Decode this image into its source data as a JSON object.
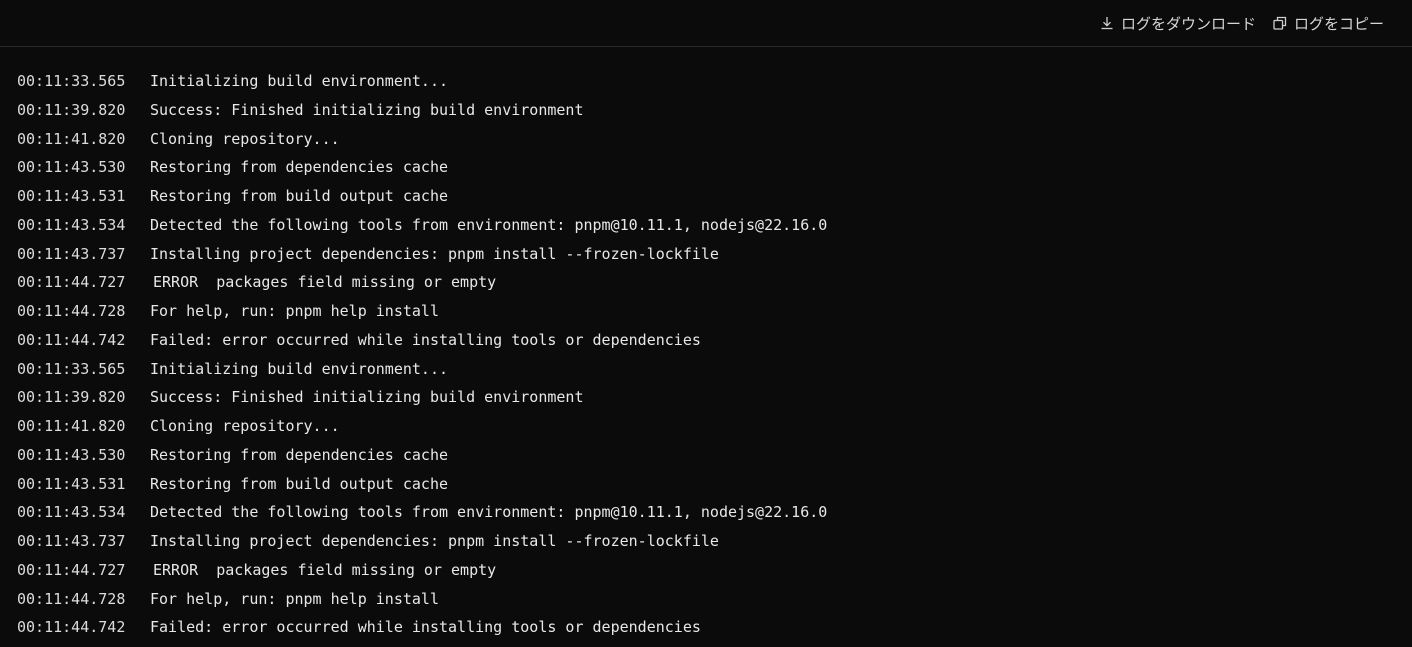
{
  "toolbar": {
    "download_label": "ログをダウンロード",
    "download_icon": "download-icon",
    "copy_label": "ログをコピー",
    "copy_icon": "copy-icon"
  },
  "log": [
    {
      "time": "00:11:33.565",
      "message": "Initializing build environment..."
    },
    {
      "time": "00:11:39.820",
      "message": "Success: Finished initializing build environment"
    },
    {
      "time": "00:11:41.820",
      "message": "Cloning repository..."
    },
    {
      "time": "00:11:43.530",
      "message": "Restoring from dependencies cache"
    },
    {
      "time": "00:11:43.531",
      "message": "Restoring from build output cache"
    },
    {
      "time": "00:11:43.534",
      "message": "Detected the following tools from environment: pnpm@10.11.1, nodejs@22.16.0"
    },
    {
      "time": "00:11:43.737",
      "message": "Installing project dependencies: pnpm install --frozen-lockfile"
    },
    {
      "time": "00:11:44.727",
      "message": "ERROR  packages field missing or empty"
    },
    {
      "time": "00:11:44.728",
      "message": "For help, run: pnpm help install"
    },
    {
      "time": "00:11:44.742",
      "message": "Failed: error occurred while installing tools or dependencies"
    },
    {
      "time": "00:11:33.565",
      "message": "Initializing build environment..."
    },
    {
      "time": "00:11:39.820",
      "message": "Success: Finished initializing build environment"
    },
    {
      "time": "00:11:41.820",
      "message": "Cloning repository..."
    },
    {
      "time": "00:11:43.530",
      "message": "Restoring from dependencies cache"
    },
    {
      "time": "00:11:43.531",
      "message": "Restoring from build output cache"
    },
    {
      "time": "00:11:43.534",
      "message": "Detected the following tools from environment: pnpm@10.11.1, nodejs@22.16.0"
    },
    {
      "time": "00:11:43.737",
      "message": "Installing project dependencies: pnpm install --frozen-lockfile"
    },
    {
      "time": "00:11:44.727",
      "message": "ERROR  packages field missing or empty"
    },
    {
      "time": "00:11:44.728",
      "message": "For help, run: pnpm help install"
    },
    {
      "time": "00:11:44.742",
      "message": "Failed: error occurred while installing tools or dependencies"
    }
  ]
}
